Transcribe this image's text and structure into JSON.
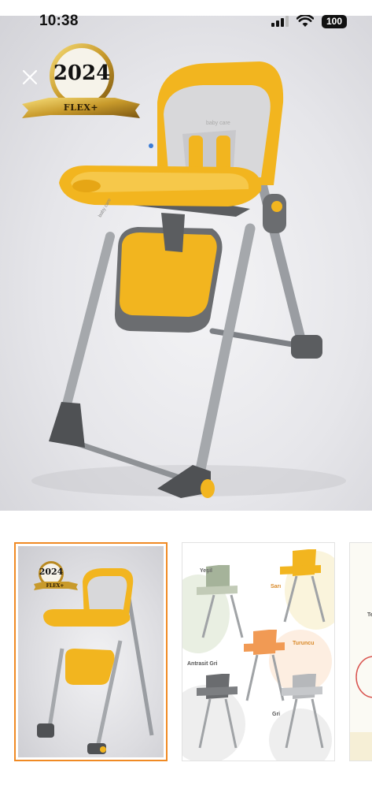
{
  "status_bar": {
    "time": "10:38",
    "battery": "100",
    "icons": [
      "cellular-signal-icon",
      "wifi-icon",
      "battery-icon"
    ]
  },
  "hero": {
    "close_icon": "close-icon",
    "badge": {
      "year": "2024",
      "ribbon": "FLEX+"
    }
  },
  "product": {
    "colors": {
      "primary": "#f2b51f",
      "cushion": "#d8d8da",
      "frame": "#8f9296",
      "base": "#555759"
    }
  },
  "thumbnails": [
    {
      "kind": "photo",
      "selected": true,
      "badge": {
        "year": "2024",
        "ribbon": "FLEX+"
      }
    },
    {
      "kind": "color-variants",
      "selected": false,
      "labels": {
        "green": "Yeşil",
        "yellow": "Sarı",
        "orange": "Turuncu",
        "anthracite": "Antrasit Gri",
        "grey": "Gri"
      }
    },
    {
      "kind": "partial",
      "selected": false,
      "text": "Te"
    }
  ],
  "accent_color": "#f08a24"
}
